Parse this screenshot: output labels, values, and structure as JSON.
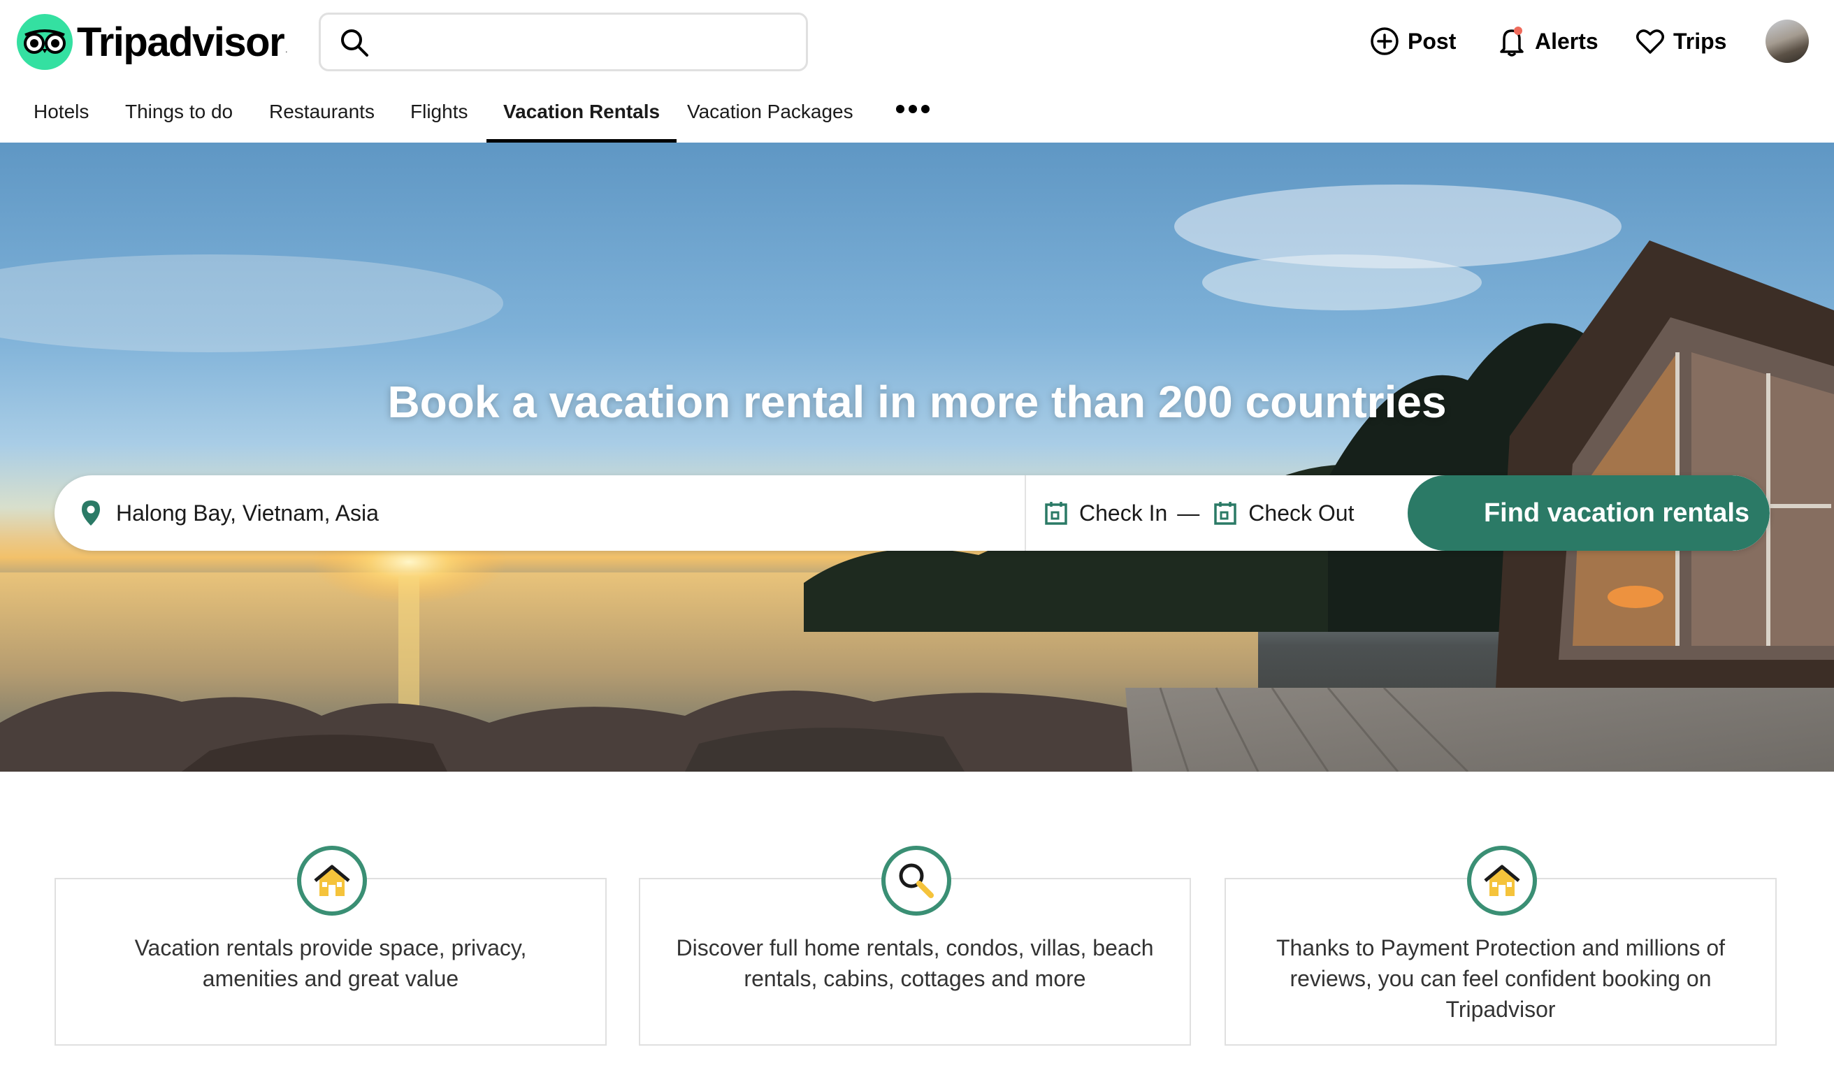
{
  "header": {
    "brand": "Tripadvisor",
    "search": {
      "value": "",
      "placeholder": ""
    },
    "actions": {
      "post": "Post",
      "alerts": "Alerts",
      "trips": "Trips"
    }
  },
  "nav": {
    "items": [
      {
        "label": "Hotels"
      },
      {
        "label": "Things to do"
      },
      {
        "label": "Restaurants"
      },
      {
        "label": "Flights"
      },
      {
        "label": "Vacation Rentals",
        "active": true
      },
      {
        "label": "Vacation Packages"
      }
    ]
  },
  "hero": {
    "title": "Book a vacation rental in more than 200 countries",
    "destination_value": "Halong Bay, Vietnam, Asia",
    "check_in": "Check In",
    "separator": "—",
    "check_out": "Check Out",
    "cta": "Find vacation rentals"
  },
  "features": [
    {
      "icon": "house-icon",
      "text": "Vacation rentals provide space, privacy, amenities and great value"
    },
    {
      "icon": "magnifier-icon",
      "text": "Discover full home rentals, condos, villas, beach rentals, cabins, cottages and more"
    },
    {
      "icon": "house-icon",
      "text": "Thanks to Payment Protection and millions of reviews, you can feel confident booking on Tripadvisor"
    }
  ],
  "colors": {
    "brand_green": "#34e0a1",
    "cta_green": "#2b7a66",
    "icon_ring": "#3a8f74",
    "alert_dot": "#ef6a5b"
  }
}
